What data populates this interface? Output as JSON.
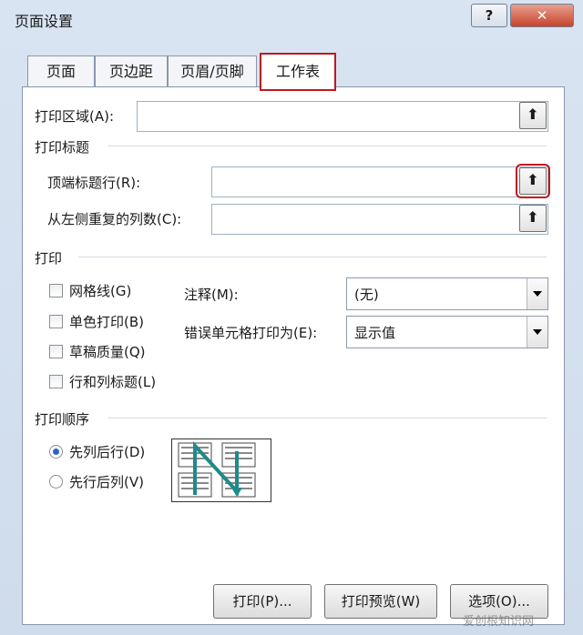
{
  "window": {
    "title": "页面设置",
    "help_label": "?",
    "close_label": "✕"
  },
  "tabs": [
    {
      "label": "页面"
    },
    {
      "label": "页边距"
    },
    {
      "label": "页眉/页脚"
    },
    {
      "label": "工作表"
    }
  ],
  "print_area": {
    "label": "打印区域(A):",
    "value": ""
  },
  "print_titles": {
    "section_label": "打印标题",
    "rows_label": "顶端标题行(R):",
    "rows_value": "",
    "cols_label": "从左侧重复的列数(C):",
    "cols_value": ""
  },
  "print": {
    "section_label": "打印",
    "checkboxes": [
      {
        "label": "网格线(G)",
        "checked": false
      },
      {
        "label": "单色打印(B)",
        "checked": false
      },
      {
        "label": "草稿质量(Q)",
        "checked": false
      },
      {
        "label": "行和列标题(L)",
        "checked": false
      }
    ],
    "comments_label": "注释(M):",
    "comments_value": "(无)",
    "errors_label": "错误单元格打印为(E):",
    "errors_value": "显示值"
  },
  "page_order": {
    "section_label": "打印顺序",
    "options": [
      {
        "label": "先列后行(D)",
        "selected": true
      },
      {
        "label": "先行后列(V)",
        "selected": false
      }
    ]
  },
  "buttons": {
    "print": "打印(P)...",
    "preview": "打印预览(W)",
    "options": "选项(O)..."
  },
  "watermark": "爱创根知识网",
  "colors": {
    "highlight": "#c0181d",
    "accent": "#2a64c8",
    "order_arrow": "#1f8a8a"
  },
  "icons": {
    "reference": "collapse-dialog-icon",
    "order": "page-order-preview-icon"
  }
}
